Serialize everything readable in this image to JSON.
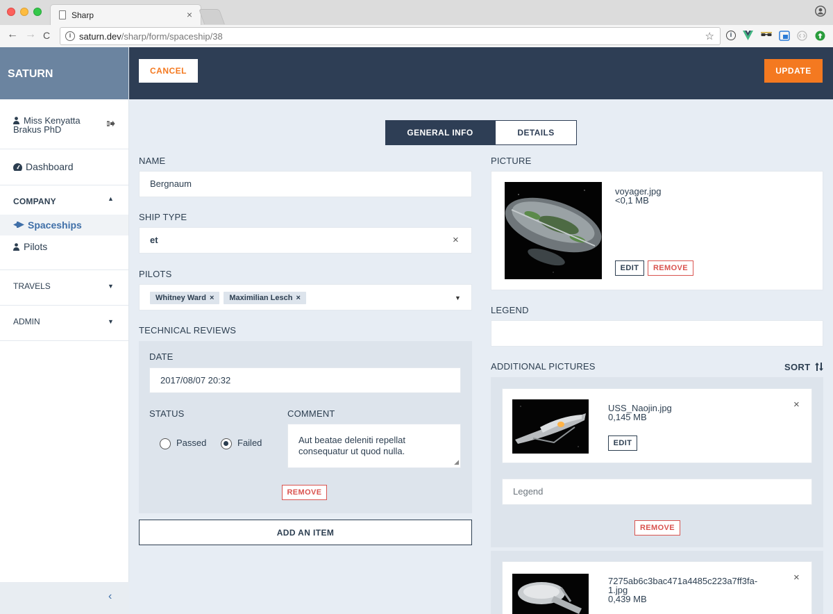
{
  "browser": {
    "tab_title": "Sharp",
    "tab_close": "×",
    "url_host": "saturn.dev",
    "url_path": "/sharp/form/spaceship/38",
    "back": "←",
    "forward": "→",
    "reload": "C",
    "star": "☆"
  },
  "sidebar": {
    "brand": "SATURN",
    "user_name_line1": "Miss Kenyatta",
    "user_name_line2": "Brakus PhD",
    "dashboard": "Dashboard",
    "company": "COMPANY",
    "spaceships": "Spaceships",
    "pilots": "Pilots",
    "travels": "TRAVELS",
    "admin": "ADMIN",
    "collapse": "‹"
  },
  "topbar": {
    "cancel": "CANCEL",
    "update": "UPDATE"
  },
  "tabs": {
    "general": "GENERAL INFO",
    "details": "DETAILS"
  },
  "form": {
    "name_label": "NAME",
    "name_value": "Bergnaum",
    "ship_type_label": "SHIP TYPE",
    "ship_type_value": "et",
    "pilots_label": "PILOTS",
    "pilots": [
      "Whitney Ward",
      "Maximilian Lesch"
    ],
    "reviews_label": "TECHNICAL REVIEWS",
    "date_label": "DATE",
    "date_value": "2017/08/07 20:32",
    "status_label": "STATUS",
    "status_passed": "Passed",
    "status_failed": "Failed",
    "comment_label": "COMMENT",
    "comment_value": "Aut beatae deleniti repellat consequatur ut quod nulla.",
    "remove": "REMOVE",
    "add_item": "ADD AN ITEM",
    "picture_label": "PICTURE",
    "picture_name": "voyager.jpg",
    "picture_size": "<0,1 MB",
    "edit": "EDIT",
    "legend_label": "LEGEND",
    "legend_value": "",
    "additional_label": "ADDITIONAL PICTURES",
    "sort": "SORT",
    "addl1_name": "USS_Naojin.jpg",
    "addl1_size": "0,145 MB",
    "addl1_legend_placeholder": "Legend",
    "addl2_name_line1": "7275ab6c3bac471a4485c223a7ff3fa-",
    "addl2_name_line2": "1.jpg",
    "addl2_size": "0,439 MB"
  }
}
